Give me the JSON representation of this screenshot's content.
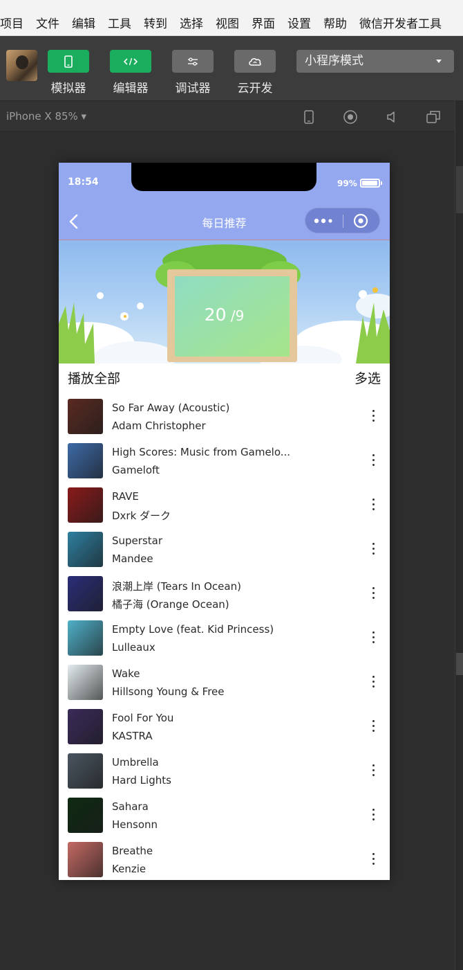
{
  "menubar": {
    "items": [
      "项目",
      "文件",
      "编辑",
      "工具",
      "转到",
      "选择",
      "视图",
      "界面",
      "设置",
      "帮助",
      "微信开发者工具"
    ]
  },
  "toolbar": {
    "tools": [
      {
        "label": "模拟器",
        "icon": "phone-icon",
        "color": "#1aad5e"
      },
      {
        "label": "编辑器",
        "icon": "code-icon",
        "color": "#1aad5e"
      },
      {
        "label": "调试器",
        "icon": "sliders-icon",
        "color": "#6a6a6a"
      },
      {
        "label": "云开发",
        "icon": "cloud-icon",
        "color": "#6a6a6a"
      }
    ],
    "mode_select": "小程序模式"
  },
  "devicebar": {
    "device": "iPhone X 85% ▾",
    "icons": [
      "phone-outline-icon",
      "record-icon",
      "speaker-icon",
      "window-icon"
    ]
  },
  "phone": {
    "status": {
      "time": "18:54",
      "battery": "99%"
    },
    "navbar": {
      "title": "每日推荐"
    },
    "banner": {
      "day": "20",
      "month": "9"
    },
    "list": {
      "play_all": "播放全部",
      "multi_select": "多选"
    },
    "songs": [
      {
        "title": "So Far Away (Acoustic)",
        "artist": "Adam Christopher",
        "cover": "#5a2a22"
      },
      {
        "title": "High Scores: Music from Gamelo...",
        "artist": "Gameloft",
        "cover": "#3d6aa8"
      },
      {
        "title": "RAVE",
        "artist": "Dxrk ダーク",
        "cover": "#8a1a1a"
      },
      {
        "title": "Superstar",
        "artist": "Mandee",
        "cover": "#2e7fa0"
      },
      {
        "title": "浪潮上岸 (Tears In Ocean)",
        "artist": "橘子海 (Orange Ocean)",
        "cover": "#2a2d78"
      },
      {
        "title": "Empty Love (feat. Kid Princess)",
        "artist": "Lulleaux",
        "cover": "#4fb0c8"
      },
      {
        "title": "Wake",
        "artist": "Hillsong Young & Free",
        "cover": "#e4ecef"
      },
      {
        "title": "Fool For You",
        "artist": "KASTRA",
        "cover": "#3a2a5a"
      },
      {
        "title": "Umbrella",
        "artist": "Hard Lights",
        "cover": "#4a5560"
      },
      {
        "title": "Sahara",
        "artist": "Hensonn",
        "cover": "#0e2a12"
      },
      {
        "title": "Breathe",
        "artist": "Kenzie",
        "cover": "#c46a64"
      }
    ]
  }
}
